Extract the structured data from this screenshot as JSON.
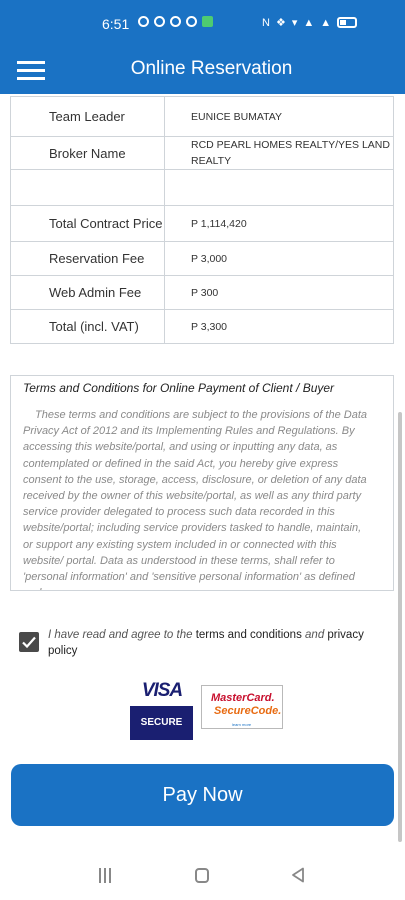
{
  "status_bar": {
    "time": "6:51",
    "right_label": "N"
  },
  "app_bar": {
    "title": "Online Reservation"
  },
  "details": [
    {
      "label": "Team Leader",
      "value": "EUNICE BUMATAY"
    },
    {
      "label": "Broker Name",
      "value": "RCD PEARL HOMES REALTY/YES LAND REALTY"
    },
    {
      "label": "",
      "value": ""
    },
    {
      "label": "Total Contract Price",
      "value": "P 1,114,420"
    },
    {
      "label": "Reservation Fee",
      "value": "P 3,000"
    },
    {
      "label": "Web Admin Fee",
      "value": "P 300"
    },
    {
      "label": "Total (incl. VAT)",
      "value": "P 3,300"
    }
  ],
  "terms": {
    "title": "Terms and Conditions for Online Payment of Client / Buyer",
    "body": "These terms and conditions are subject to the provisions of the Data Privacy Act of 2012 and its Implementing Rules and Regulations. By accessing this website/portal, and using or inputting any data, as contemplated or defined in the said Act, you hereby give express consent to the use, storage, access, disclosure, or deletion of any data received by the owner of this website/portal, as well as any third party service provider delegated to process such data recorded in this website/portal; including service providers tasked to handle, maintain, or support any existing system included in or connected with this website/ portal. Data as understood in these terms, shall refer to 'personal information' and 'sensitive personal information' as defined under"
  },
  "agreement": {
    "checked": true,
    "prefix": "I have read and agree to the ",
    "terms_link": "terms and conditions",
    "middle": " and ",
    "privacy_link": "privacy policy"
  },
  "badges": {
    "visa_word": "VISA",
    "visa_secure": "SECURE",
    "mc_line1": "MasterCard.",
    "mc_line2": "SecureCode.",
    "mc_learn": "learn more"
  },
  "pay_button": {
    "label": "Pay Now"
  },
  "colors": {
    "primary": "#1a72c4",
    "visa_blue": "#1a1f71",
    "mc_red": "#c8102e",
    "mc_orange": "#e86b12"
  }
}
